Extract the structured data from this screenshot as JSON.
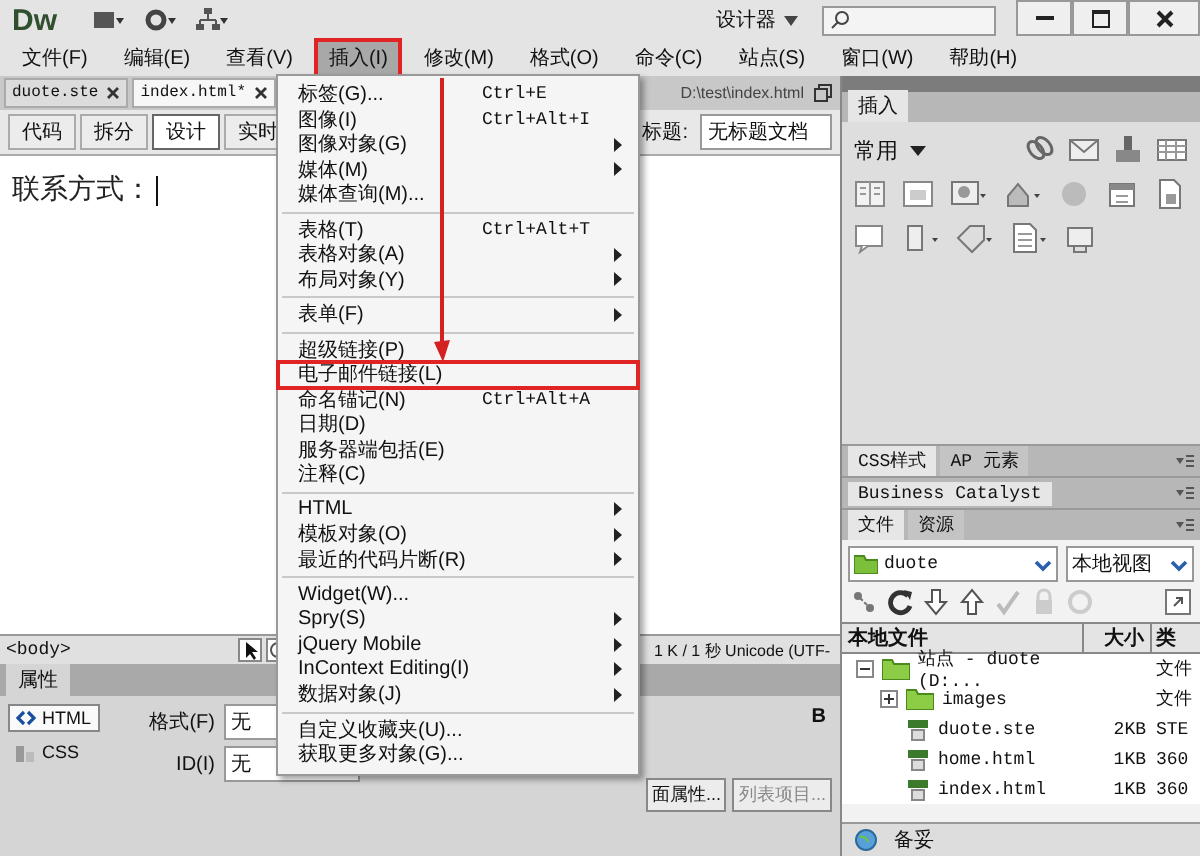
{
  "app": {
    "logo": "Dw",
    "workspace": "设计器"
  },
  "menu_bar": [
    {
      "label": "文件(F)",
      "selected": false,
      "highlighted": false
    },
    {
      "label": "编辑(E)",
      "selected": false,
      "highlighted": false
    },
    {
      "label": "查看(V)",
      "selected": false,
      "highlighted": false
    },
    {
      "label": "插入(I)",
      "selected": true,
      "highlighted": true
    },
    {
      "label": "修改(M)",
      "selected": false,
      "highlighted": false
    },
    {
      "label": "格式(O)",
      "selected": false,
      "highlighted": false
    },
    {
      "label": "命令(C)",
      "selected": false,
      "highlighted": false
    },
    {
      "label": "站点(S)",
      "selected": false,
      "highlighted": false
    },
    {
      "label": "窗口(W)",
      "selected": false,
      "highlighted": false
    },
    {
      "label": "帮助(H)",
      "selected": false,
      "highlighted": false
    }
  ],
  "document_tabs": [
    {
      "label": "duote.ste",
      "selected": false
    },
    {
      "label": "index.html*",
      "selected": true
    }
  ],
  "document_path": "D:\\test\\index.html",
  "view_buttons": [
    {
      "label": "代码",
      "selected": false
    },
    {
      "label": "拆分",
      "selected": false
    },
    {
      "label": "设计",
      "selected": true
    },
    {
      "label": "实时",
      "selected": false
    }
  ],
  "title_label": "标题:",
  "title_value": "无标题文档",
  "document_text": "联系方式：",
  "status_bar": {
    "tag": "<body>",
    "info": "1 K / 1 秒 Unicode (UTF-"
  },
  "properties": {
    "tab": "属性",
    "modes": [
      {
        "label": "HTML",
        "selected": true
      },
      {
        "label": "CSS",
        "selected": false
      }
    ],
    "fields": [
      {
        "label": "格式(F)",
        "value": "无"
      },
      {
        "label": "ID(I)",
        "value": "无"
      }
    ],
    "bold_button": "B",
    "page_properties_button": "面属性...",
    "list_item_button": "列表项目..."
  },
  "insert_menu": [
    [
      {
        "label": "标签(G)...",
        "shortcut": "Ctrl+E",
        "submenu": false,
        "highlighted": false
      },
      {
        "label": "图像(I)",
        "shortcut": "Ctrl+Alt+I",
        "submenu": false,
        "highlighted": false
      },
      {
        "label": "图像对象(G)",
        "submenu": true,
        "highlighted": false
      },
      {
        "label": "媒体(M)",
        "submenu": true,
        "highlighted": false
      },
      {
        "label": "媒体查询(M)...",
        "submenu": false,
        "highlighted": false
      }
    ],
    [
      {
        "label": "表格(T)",
        "shortcut": "Ctrl+Alt+T",
        "submenu": false,
        "highlighted": false
      },
      {
        "label": "表格对象(A)",
        "submenu": true,
        "highlighted": false
      },
      {
        "label": "布局对象(Y)",
        "submenu": true,
        "highlighted": false
      }
    ],
    [
      {
        "label": "表单(F)",
        "submenu": true,
        "highlighted": false
      }
    ],
    [
      {
        "label": "超级链接(P)",
        "submenu": false,
        "highlighted": false
      },
      {
        "label": "电子邮件链接(L)",
        "submenu": false,
        "highlighted": true
      },
      {
        "label": "命名锚记(N)",
        "shortcut": "Ctrl+Alt+A",
        "submenu": false,
        "highlighted": false
      },
      {
        "label": "日期(D)",
        "submenu": false,
        "highlighted": false
      },
      {
        "label": "服务器端包括(E)",
        "submenu": false,
        "highlighted": false
      },
      {
        "label": "注释(C)",
        "submenu": false,
        "highlighted": false
      }
    ],
    [
      {
        "label": "HTML",
        "submenu": true,
        "highlighted": false
      },
      {
        "label": "模板对象(O)",
        "submenu": true,
        "highlighted": false
      },
      {
        "label": "最近的代码片断(R)",
        "submenu": true,
        "highlighted": false
      }
    ],
    [
      {
        "label": "Widget(W)...",
        "submenu": false,
        "highlighted": false
      },
      {
        "label": "Spry(S)",
        "submenu": true,
        "highlighted": false
      },
      {
        "label": "jQuery Mobile",
        "submenu": true,
        "highlighted": false
      },
      {
        "label": "InContext Editing(I)",
        "submenu": true,
        "highlighted": false
      },
      {
        "label": "数据对象(J)",
        "submenu": true,
        "highlighted": false
      }
    ],
    [
      {
        "label": "自定义收藏夹(U)...",
        "submenu": false,
        "highlighted": false
      },
      {
        "label": "获取更多对象(G)...",
        "submenu": false,
        "highlighted": false
      }
    ]
  ],
  "insert_panel": {
    "tab": "插入",
    "category": "常用"
  },
  "panel_groups": [
    [
      {
        "label": "CSS样式",
        "selected": true
      },
      {
        "label": "AP 元素",
        "selected": false
      }
    ],
    [
      {
        "label": "Business Catalyst",
        "selected": true
      }
    ],
    [
      {
        "label": "文件",
        "selected": true
      },
      {
        "label": "资源",
        "selected": false
      }
    ]
  ],
  "files": {
    "site": "duote",
    "view": "本地视图",
    "columns": [
      "本地文件",
      "大小",
      "类"
    ],
    "tree": [
      {
        "name": "站点 - duote (D:...",
        "type": "文件",
        "kind": "site",
        "expanded": true,
        "children": [
          {
            "name": "images",
            "type": "文件",
            "kind": "folder",
            "expanded": false
          },
          {
            "name": "duote.ste",
            "size": "2KB",
            "type": "STE",
            "kind": "file"
          },
          {
            "name": "home.html",
            "size": "1KB",
            "type": "360",
            "kind": "file"
          },
          {
            "name": "index.html",
            "size": "1KB",
            "type": "360",
            "kind": "file"
          }
        ]
      }
    ],
    "status": "备妥"
  }
}
